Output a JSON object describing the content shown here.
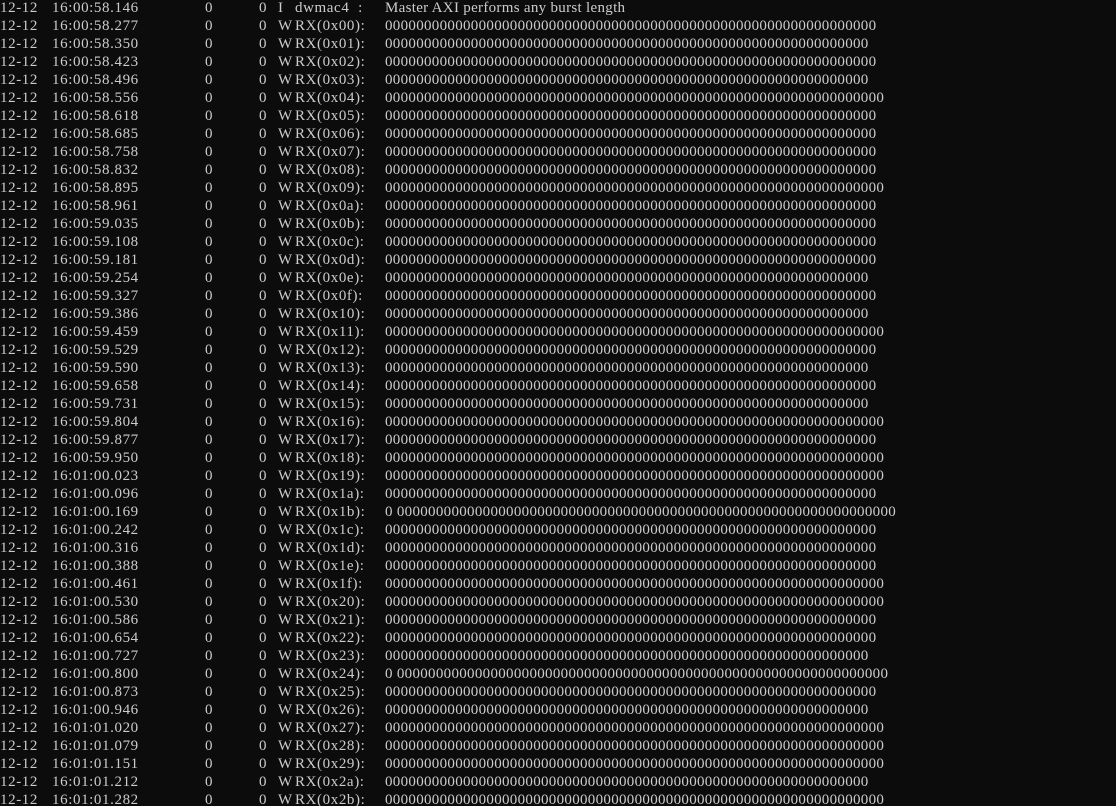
{
  "terminal": {
    "lines": [
      {
        "date": "12-12",
        "time": "16:00:58.146",
        "pid": "0",
        "tid": "0",
        "level": "I",
        "tag": "dwmac4  :",
        "message": "Master AXI performs any burst length"
      },
      {
        "date": "12-12",
        "time": "16:00:58.277",
        "pid": "0",
        "tid": "0",
        "level": "W",
        "tag": "RX(0x00):",
        "message": "000000000000000000000000000000000000000000000000000000000000000"
      },
      {
        "date": "12-12",
        "time": "16:00:58.350",
        "pid": "0",
        "tid": "0",
        "level": "W",
        "tag": "RX(0x01):",
        "message": "00000000000000000000000000000000000000000000000000000000000000"
      },
      {
        "date": "12-12",
        "time": "16:00:58.423",
        "pid": "0",
        "tid": "0",
        "level": "W",
        "tag": "RX(0x02):",
        "message": "000000000000000000000000000000000000000000000000000000000000000"
      },
      {
        "date": "12-12",
        "time": "16:00:58.496",
        "pid": "0",
        "tid": "0",
        "level": "W",
        "tag": "RX(0x03):",
        "message": "00000000000000000000000000000000000000000000000000000000000000"
      },
      {
        "date": "12-12",
        "time": "16:00:58.556",
        "pid": "0",
        "tid": "0",
        "level": "W",
        "tag": "RX(0x04):",
        "message": "0000000000000000000000000000000000000000000000000000000000000000"
      },
      {
        "date": "12-12",
        "time": "16:00:58.618",
        "pid": "0",
        "tid": "0",
        "level": "W",
        "tag": "RX(0x05):",
        "message": "000000000000000000000000000000000000000000000000000000000000000"
      },
      {
        "date": "12-12",
        "time": "16:00:58.685",
        "pid": "0",
        "tid": "0",
        "level": "W",
        "tag": "RX(0x06):",
        "message": "000000000000000000000000000000000000000000000000000000000000000"
      },
      {
        "date": "12-12",
        "time": "16:00:58.758",
        "pid": "0",
        "tid": "0",
        "level": "W",
        "tag": "RX(0x07):",
        "message": "000000000000000000000000000000000000000000000000000000000000000"
      },
      {
        "date": "12-12",
        "time": "16:00:58.832",
        "pid": "0",
        "tid": "0",
        "level": "W",
        "tag": "RX(0x08):",
        "message": "000000000000000000000000000000000000000000000000000000000000000"
      },
      {
        "date": "12-12",
        "time": "16:00:58.895",
        "pid": "0",
        "tid": "0",
        "level": "W",
        "tag": "RX(0x09):",
        "message": "0000000000000000000000000000000000000000000000000000000000000000"
      },
      {
        "date": "12-12",
        "time": "16:00:58.961",
        "pid": "0",
        "tid": "0",
        "level": "W",
        "tag": "RX(0x0a):",
        "message": "000000000000000000000000000000000000000000000000000000000000000"
      },
      {
        "date": "12-12",
        "time": "16:00:59.035",
        "pid": "0",
        "tid": "0",
        "level": "W",
        "tag": "RX(0x0b):",
        "message": "000000000000000000000000000000000000000000000000000000000000000"
      },
      {
        "date": "12-12",
        "time": "16:00:59.108",
        "pid": "0",
        "tid": "0",
        "level": "W",
        "tag": "RX(0x0c):",
        "message": "000000000000000000000000000000000000000000000000000000000000000"
      },
      {
        "date": "12-12",
        "time": "16:00:59.181",
        "pid": "0",
        "tid": "0",
        "level": "W",
        "tag": "RX(0x0d):",
        "message": "000000000000000000000000000000000000000000000000000000000000000"
      },
      {
        "date": "12-12",
        "time": "16:00:59.254",
        "pid": "0",
        "tid": "0",
        "level": "W",
        "tag": "RX(0x0e):",
        "message": "00000000000000000000000000000000000000000000000000000000000000"
      },
      {
        "date": "12-12",
        "time": "16:00:59.327",
        "pid": "0",
        "tid": "0",
        "level": "W",
        "tag": "RX(0x0f):",
        "message": "000000000000000000000000000000000000000000000000000000000000000"
      },
      {
        "date": "12-12",
        "time": "16:00:59.386",
        "pid": "0",
        "tid": "0",
        "level": "W",
        "tag": "RX(0x10):",
        "message": "00000000000000000000000000000000000000000000000000000000000000"
      },
      {
        "date": "12-12",
        "time": "16:00:59.459",
        "pid": "0",
        "tid": "0",
        "level": "W",
        "tag": "RX(0x11):",
        "message": "0000000000000000000000000000000000000000000000000000000000000000"
      },
      {
        "date": "12-12",
        "time": "16:00:59.529",
        "pid": "0",
        "tid": "0",
        "level": "W",
        "tag": "RX(0x12):",
        "message": "000000000000000000000000000000000000000000000000000000000000000"
      },
      {
        "date": "12-12",
        "time": "16:00:59.590",
        "pid": "0",
        "tid": "0",
        "level": "W",
        "tag": "RX(0x13):",
        "message": "00000000000000000000000000000000000000000000000000000000000000"
      },
      {
        "date": "12-12",
        "time": "16:00:59.658",
        "pid": "0",
        "tid": "0",
        "level": "W",
        "tag": "RX(0x14):",
        "message": "000000000000000000000000000000000000000000000000000000000000000"
      },
      {
        "date": "12-12",
        "time": "16:00:59.731",
        "pid": "0",
        "tid": "0",
        "level": "W",
        "tag": "RX(0x15):",
        "message": "00000000000000000000000000000000000000000000000000000000000000"
      },
      {
        "date": "12-12",
        "time": "16:00:59.804",
        "pid": "0",
        "tid": "0",
        "level": "W",
        "tag": "RX(0x16):",
        "message": "0000000000000000000000000000000000000000000000000000000000000000"
      },
      {
        "date": "12-12",
        "time": "16:00:59.877",
        "pid": "0",
        "tid": "0",
        "level": "W",
        "tag": "RX(0x17):",
        "message": "000000000000000000000000000000000000000000000000000000000000000"
      },
      {
        "date": "12-12",
        "time": "16:00:59.950",
        "pid": "0",
        "tid": "0",
        "level": "W",
        "tag": "RX(0x18):",
        "message": "0000000000000000000000000000000000000000000000000000000000000000"
      },
      {
        "date": "12-12",
        "time": "16:01:00.023",
        "pid": "0",
        "tid": "0",
        "level": "W",
        "tag": "RX(0x19):",
        "message": "0000000000000000000000000000000000000000000000000000000000000000"
      },
      {
        "date": "12-12",
        "time": "16:01:00.096",
        "pid": "0",
        "tid": "0",
        "level": "W",
        "tag": "RX(0x1a):",
        "message": "000000000000000000000000000000000000000000000000000000000000000"
      },
      {
        "date": "12-12",
        "time": "16:01:00.169",
        "pid": "0",
        "tid": "0",
        "level": "W",
        "tag": "RX(0x1b):",
        "message": "0 0000000000000000000000000000000000000000000000000000000000000000"
      },
      {
        "date": "12-12",
        "time": "16:01:00.242",
        "pid": "0",
        "tid": "0",
        "level": "W",
        "tag": "RX(0x1c):",
        "message": "000000000000000000000000000000000000000000000000000000000000000"
      },
      {
        "date": "12-12",
        "time": "16:01:00.316",
        "pid": "0",
        "tid": "0",
        "level": "W",
        "tag": "RX(0x1d):",
        "message": "000000000000000000000000000000000000000000000000000000000000000"
      },
      {
        "date": "12-12",
        "time": "16:01:00.388",
        "pid": "0",
        "tid": "0",
        "level": "W",
        "tag": "RX(0x1e):",
        "message": "000000000000000000000000000000000000000000000000000000000000000"
      },
      {
        "date": "12-12",
        "time": "16:01:00.461",
        "pid": "0",
        "tid": "0",
        "level": "W",
        "tag": "RX(0x1f):",
        "message": "0000000000000000000000000000000000000000000000000000000000000000"
      },
      {
        "date": "12-12",
        "time": "16:01:00.530",
        "pid": "0",
        "tid": "0",
        "level": "W",
        "tag": "RX(0x20):",
        "message": "0000000000000000000000000000000000000000000000000000000000000000"
      },
      {
        "date": "12-12",
        "time": "16:01:00.586",
        "pid": "0",
        "tid": "0",
        "level": "W",
        "tag": "RX(0x21):",
        "message": "000000000000000000000000000000000000000000000000000000000000000"
      },
      {
        "date": "12-12",
        "time": "16:01:00.654",
        "pid": "0",
        "tid": "0",
        "level": "W",
        "tag": "RX(0x22):",
        "message": "000000000000000000000000000000000000000000000000000000000000000"
      },
      {
        "date": "12-12",
        "time": "16:01:00.727",
        "pid": "0",
        "tid": "0",
        "level": "W",
        "tag": "RX(0x23):",
        "message": "00000000000000000000000000000000000000000000000000000000000000"
      },
      {
        "date": "12-12",
        "time": "16:01:00.800",
        "pid": "0",
        "tid": "0",
        "level": "W",
        "tag": "RX(0x24):",
        "message": "0 000000000000000000000000000000000000000000000000000000000000000"
      },
      {
        "date": "12-12",
        "time": "16:01:00.873",
        "pid": "0",
        "tid": "0",
        "level": "W",
        "tag": "RX(0x25):",
        "message": "000000000000000000000000000000000000000000000000000000000000000"
      },
      {
        "date": "12-12",
        "time": "16:01:00.946",
        "pid": "0",
        "tid": "0",
        "level": "W",
        "tag": "RX(0x26):",
        "message": "00000000000000000000000000000000000000000000000000000000000000"
      },
      {
        "date": "12-12",
        "time": "16:01:01.020",
        "pid": "0",
        "tid": "0",
        "level": "W",
        "tag": "RX(0x27):",
        "message": "0000000000000000000000000000000000000000000000000000000000000000"
      },
      {
        "date": "12-12",
        "time": "16:01:01.079",
        "pid": "0",
        "tid": "0",
        "level": "W",
        "tag": "RX(0x28):",
        "message": "0000000000000000000000000000000000000000000000000000000000000000"
      },
      {
        "date": "12-12",
        "time": "16:01:01.151",
        "pid": "0",
        "tid": "0",
        "level": "W",
        "tag": "RX(0x29):",
        "message": "0000000000000000000000000000000000000000000000000000000000000000"
      },
      {
        "date": "12-12",
        "time": "16:01:01.212",
        "pid": "0",
        "tid": "0",
        "level": "W",
        "tag": "RX(0x2a):",
        "message": "00000000000000000000000000000000000000000000000000000000000000"
      },
      {
        "date": "12-12",
        "time": "16:01:01.282",
        "pid": "0",
        "tid": "0",
        "level": "W",
        "tag": "RX(0x2b):",
        "message": "0000000000000000000000000000000000000000000000000000000000000000"
      }
    ]
  },
  "colors": {
    "background": "#0c0c0c",
    "text": "#cccccc"
  }
}
